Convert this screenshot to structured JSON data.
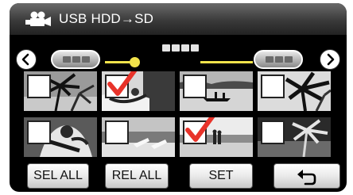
{
  "header": {
    "icon": "video-camera-icon",
    "title": "USB HDD→SD"
  },
  "timeline": {
    "prev_icon": "chevron-left-icon",
    "next_icon": "chevron-right-icon",
    "progress": 0.2
  },
  "thumbnails": [
    {
      "checked": false
    },
    {
      "checked": true
    },
    {
      "checked": false
    },
    {
      "checked": false
    },
    {
      "checked": false
    },
    {
      "checked": false
    },
    {
      "checked": true
    },
    {
      "checked": false
    }
  ],
  "colors": {
    "check": "#e8332a",
    "accent": "#f2e34b"
  },
  "buttons": {
    "sel_all": "SEL ALL",
    "rel_all": "REL ALL",
    "set": "SET",
    "back_icon": "return-arrow-icon"
  }
}
